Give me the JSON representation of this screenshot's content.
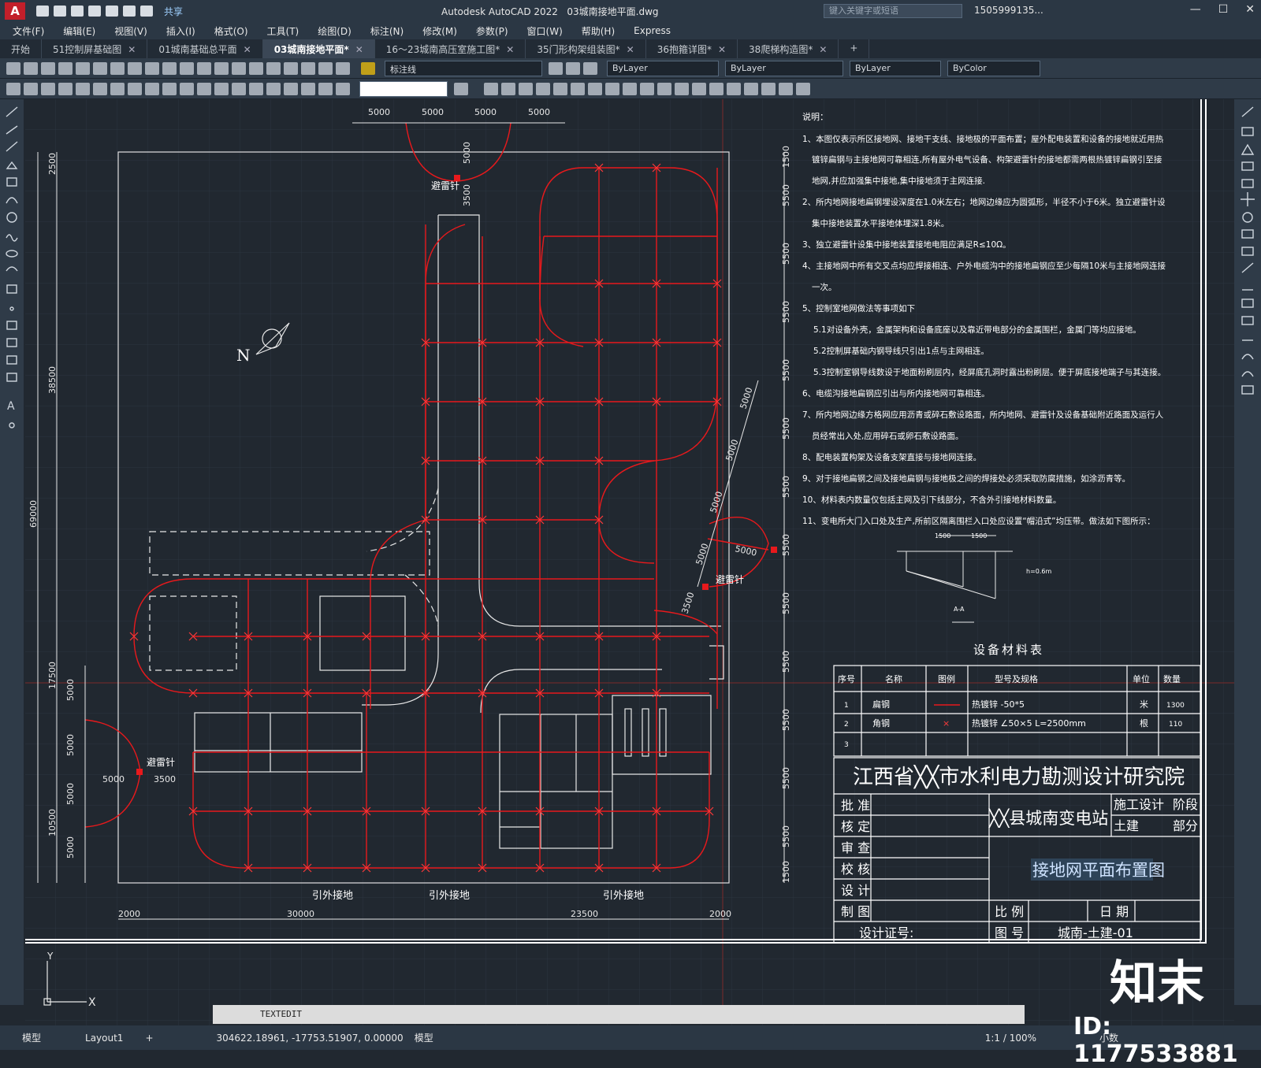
{
  "app": {
    "title": "Autodesk AutoCAD 2022",
    "file": "03城南接地平面.dwg",
    "share_label": "共享",
    "search_placeholder": "键入关键字或短语",
    "user": "1505999135...",
    "logo": "A"
  },
  "menu": [
    "文件(F)",
    "编辑(E)",
    "视图(V)",
    "插入(I)",
    "格式(O)",
    "工具(T)",
    "绘图(D)",
    "标注(N)",
    "修改(M)",
    "参数(P)",
    "窗口(W)",
    "帮助(H)",
    "Express"
  ],
  "tabs": [
    {
      "label": "开始",
      "active": false
    },
    {
      "label": "51控制屏基础图",
      "active": false
    },
    {
      "label": "01城南基础总平面",
      "active": false
    },
    {
      "label": "03城南接地平面*",
      "active": true
    },
    {
      "label": "16～23城南高压室施工图*",
      "active": false
    },
    {
      "label": "35门形构架组装图*",
      "active": false
    },
    {
      "label": "36抱箍详图*",
      "active": false
    },
    {
      "label": "38爬梯构造图*",
      "active": false
    }
  ],
  "properties": {
    "layer": "标注线",
    "color": "ByLayer",
    "linetype": "ByLayer",
    "lineweight": "ByLayer",
    "plotstyle": "ByColor"
  },
  "command": {
    "text": "TEXTEDIT"
  },
  "status": {
    "layouts": [
      "模型",
      "Layout1"
    ],
    "coords": "304622.18961, -17753.51907, 0.00000",
    "mode": "模型",
    "scale": "1:1 / 100%",
    "units": "小数"
  },
  "drawing": {
    "notes_title": "说明：",
    "notes": [
      "1、本图仅表示所区接地网、接地干支线、接地极的平面布置；屋外配电装置和设备的接地就近用热",
      "镀锌扁钢与主接地网可靠相连,所有屋外电气设备、构架避雷针的接地都需两根热镀锌扁钢引至接",
      "地网,并应加强集中接地,集中接地须于主网连接.",
      "2、所内地网接地扁钢埋设深度在1.0米左右；地网边缘应为圆弧形，半径不小于6米。独立避雷针设",
      "集中接地装置水平接地体埋深1.8米。",
      "3、独立避雷针设集中接地装置接地电阻应满足R≤10Ω。",
      "4、主接地网中所有交叉点均应焊接相连、户外电缆沟中的接地扁钢应至少每隔10米与主接地网连接",
      "一次。",
      "5、控制室地网做法等事项如下",
      "5.1对设备外壳，金属架构和设备底座以及靠近带电部分的金属围栏，金属门等均应接地。",
      "5.2控制屏基础内钢导线只引出1点与主网相连。",
      "5.3控制室钢导线数设于地面粉刷层内，经屏底孔洞时露出粉刷层。便于屏底接地端子与其连接。",
      "6、电缆沟接地扁钢应引出与所内接地网可靠相连。",
      "7、所内地网边缘方格网应用沥青或碎石敷设路面，所内地网、避雷针及设备基础附近路面及运行人",
      "员经常出入处,应用碎石或卵石敷设路面。",
      "8、配电装置构架及设备支架直接与接地网连接。",
      "9、对于接地扁钢之间及接地扁钢与接地极之间的焊接处必须采取防腐措施，如涂沥青等。",
      "10、材料表内数量仅包括主网及引下线部分，不含外引接地材料数量。",
      "11、变电所大门入口处及生产,所前区隔离围栏入口处应设置“帽沿式”均压带。做法如下图所示："
    ],
    "section_label": "A-A",
    "section_h": "h=0.6m",
    "section_dims": [
      "1500",
      "1500"
    ],
    "table_title": "设备材料表",
    "table_headers": [
      "序号",
      "名称",
      "图例",
      "型号及规格",
      "单位",
      "数量"
    ],
    "table_rows": [
      [
        "1",
        "扁钢",
        "",
        "热镀锌 -50*5",
        "米",
        "1300"
      ],
      [
        "2",
        "角钢",
        "×",
        "热镀锌 ∠50×5 L=2500mm",
        "根",
        "110"
      ],
      [
        "3",
        "",
        "",
        "",
        "",
        ""
      ]
    ],
    "institute": "江西省╳╳市水利电力勘测设计研究院",
    "project": "╳╳县城南变电站",
    "stage_labels": [
      "施工设计",
      "阶段",
      "土建",
      "部分"
    ],
    "drawing_title": "接地网平面布置图",
    "sign_roles": [
      "批 准",
      "核 定",
      "审 查",
      "校 核",
      "设 计",
      "制 图"
    ],
    "scale_label": "比 例",
    "date_label": "日 期",
    "number_label": "图 号",
    "number_value": "城南-土建-01",
    "cert_label": "设计证号:",
    "lightning_label": "避雷针",
    "lead_label": "引外接地",
    "north": "N",
    "top_dims": [
      "5000",
      "5000",
      "5000",
      "5000"
    ],
    "bottom_dims": [
      "2000",
      "30000",
      "23500",
      "2000"
    ],
    "left_dims": [
      "2500",
      "38500",
      "69000",
      "17500",
      "10500"
    ],
    "left_small_dims": [
      "5000",
      "5000",
      "5000",
      "5000"
    ],
    "right_dims": [
      "1500",
      "5500",
      "5500",
      "5500",
      "5500",
      "5500",
      "5500",
      "5500",
      "5500",
      "5500",
      "5500",
      "5500",
      "5500",
      "1500"
    ],
    "diag_dims": [
      "5000",
      "5000",
      "5000",
      "5000",
      "3500",
      "5000"
    ],
    "small_dims": [
      "5000",
      "3500",
      "3500",
      "5000"
    ]
  },
  "watermark": {
    "brand": "知末",
    "id": "ID: 1177533881"
  },
  "ucs": {
    "x": "X",
    "y": "Y"
  }
}
